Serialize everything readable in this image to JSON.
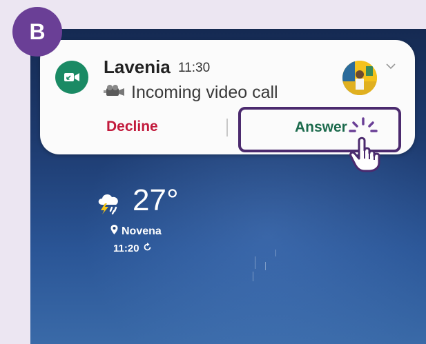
{
  "step_badge": "B",
  "notification": {
    "caller_name": "Lavenia",
    "time": "11:30",
    "subtitle": "Incoming video call",
    "decline_label": "Decline",
    "answer_label": "Answer"
  },
  "weather": {
    "temperature": "27°",
    "location": "Novena",
    "updated_time": "11:20"
  },
  "colors": {
    "badge": "#6a3f96",
    "decline": "#c21a3c",
    "answer": "#1b6a4c",
    "app_icon": "#1a8a64",
    "highlight_border": "#4b2a6e"
  },
  "icons": [
    "video-call-icon",
    "camcorder-icon",
    "chevron-down-icon",
    "tap-hand-icon",
    "storm-icon",
    "location-pin-icon",
    "refresh-icon"
  ]
}
